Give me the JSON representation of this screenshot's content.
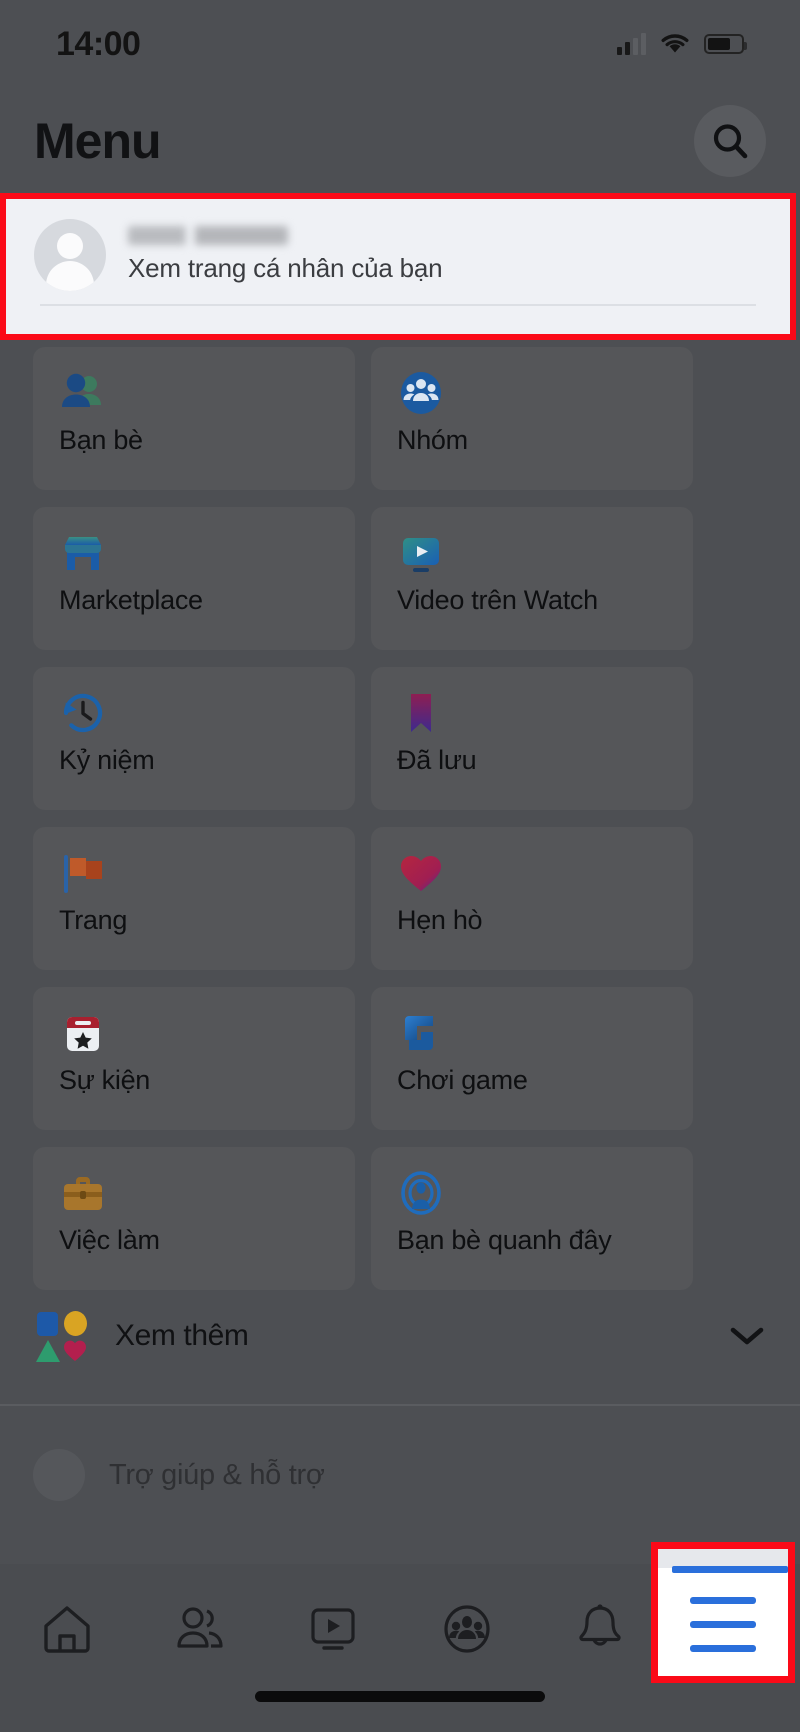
{
  "status_bar": {
    "time": "14:00",
    "signal_icon": "cellular-signal-icon",
    "wifi_icon": "wifi-icon",
    "battery_icon": "battery-icon",
    "battery_level": "70"
  },
  "header": {
    "title": "Menu",
    "search_icon": "search-icon"
  },
  "profile": {
    "name": "",
    "subtitle": "Xem trang cá nhân của bạn",
    "avatar_icon": "avatar-placeholder-icon",
    "highlight_color": "#fb0a18",
    "background": "#eff1f5"
  },
  "grid": {
    "tiles": [
      {
        "label": "Bạn bè",
        "icon": "friends-icon"
      },
      {
        "label": "Nhóm",
        "icon": "groups-icon"
      },
      {
        "label": "Marketplace",
        "icon": "marketplace-icon"
      },
      {
        "label": "Video trên Watch",
        "icon": "watch-video-icon"
      },
      {
        "label": "Kỷ niệm",
        "icon": "memories-clock-icon"
      },
      {
        "label": "Đã lưu",
        "icon": "bookmark-saved-icon"
      },
      {
        "label": "Trang",
        "icon": "pages-flag-icon"
      },
      {
        "label": "Hẹn hò",
        "icon": "dating-heart-icon"
      },
      {
        "label": "Sự kiện",
        "icon": "events-calendar-icon"
      },
      {
        "label": "Chơi game",
        "icon": "gaming-icon"
      },
      {
        "label": "Việc làm",
        "icon": "jobs-briefcase-icon"
      },
      {
        "label": "Bạn bè quanh đây",
        "icon": "nearby-friends-icon"
      }
    ]
  },
  "see_more": {
    "label": "Xem thêm",
    "icon": "shapes-icon",
    "chevron_icon": "chevron-down-icon"
  },
  "partial_row": {
    "label": "Trợ giúp & hỗ trợ"
  },
  "bottom_nav": {
    "items": [
      {
        "name": "home",
        "icon": "home-icon"
      },
      {
        "name": "friends",
        "icon": "friends-outline-icon"
      },
      {
        "name": "watch",
        "icon": "watch-outline-icon"
      },
      {
        "name": "groups",
        "icon": "groups-outline-icon"
      },
      {
        "name": "notifications",
        "icon": "bell-icon"
      },
      {
        "name": "menu",
        "icon": "hamburger-menu-icon"
      }
    ],
    "active": "menu",
    "highlight_color": "#fb0a18",
    "accent_color": "#2a6fdb"
  }
}
